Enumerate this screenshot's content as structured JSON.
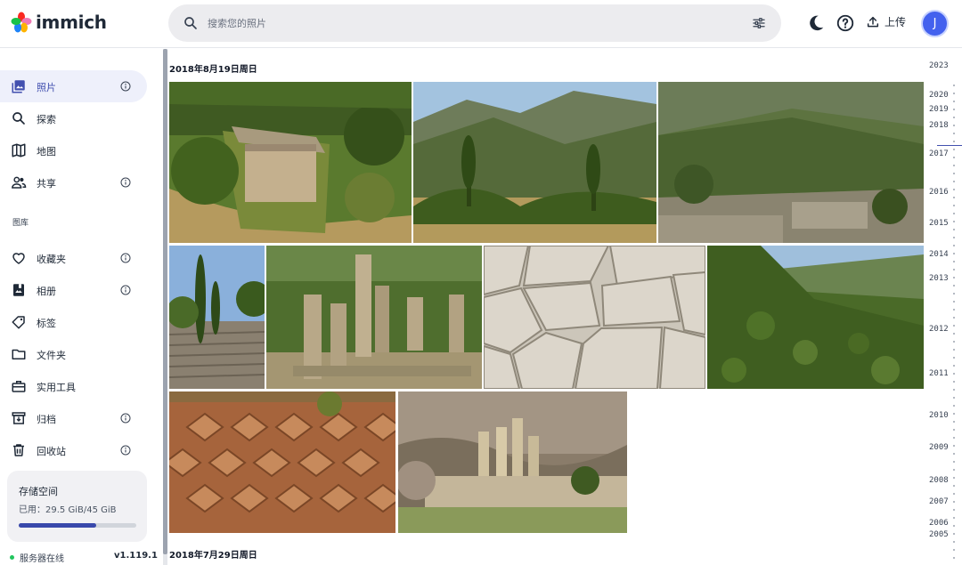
{
  "app": {
    "name": "immich"
  },
  "search": {
    "placeholder": "搜索您的照片",
    "icon": "search-icon",
    "filter_icon": "tune-icon"
  },
  "header": {
    "theme_icon": "moon-icon",
    "help_icon": "help-icon",
    "upload_label": "上传",
    "avatar_initial": "J"
  },
  "sidebar": {
    "items": [
      {
        "label": "照片",
        "icon": "photos-icon",
        "info": true,
        "active": true
      },
      {
        "label": "探索",
        "icon": "explore-icon",
        "info": false
      },
      {
        "label": "地图",
        "icon": "map-icon",
        "info": false
      },
      {
        "label": "共享",
        "icon": "sharing-icon",
        "info": true
      }
    ],
    "library_label": "图库",
    "library_items": [
      {
        "label": "收藏夹",
        "icon": "heart-icon",
        "info": true
      },
      {
        "label": "相册",
        "icon": "album-icon",
        "info": true
      },
      {
        "label": "标签",
        "icon": "tag-icon",
        "info": false
      },
      {
        "label": "文件夹",
        "icon": "folder-icon",
        "info": false
      },
      {
        "label": "实用工具",
        "icon": "toolbox-icon",
        "info": false
      },
      {
        "label": "归档",
        "icon": "archive-icon",
        "info": true
      },
      {
        "label": "回收站",
        "icon": "trash-icon",
        "info": true
      }
    ]
  },
  "storage": {
    "title": "存储空间",
    "usage": "已用：29.5 GiB/45 GiB",
    "used_fraction": 0.656
  },
  "server": {
    "status": "服务器在线",
    "version": "v1.119.1",
    "status_color": "#22c55e"
  },
  "groups": [
    {
      "date": "2018年8月19日周日"
    },
    {
      "date": "2018年7月29日周日"
    }
  ],
  "timeline": {
    "years": [
      "2023",
      "2020",
      "2019",
      "2018",
      "2017",
      "2016",
      "2015",
      "2014",
      "2013",
      "2012",
      "2011",
      "2010",
      "2009",
      "2008",
      "2007",
      "2006",
      "2005"
    ]
  },
  "colors": {
    "accent": "#4250af",
    "avatar": "#4361ee",
    "active_bg": "#eef0fb"
  }
}
